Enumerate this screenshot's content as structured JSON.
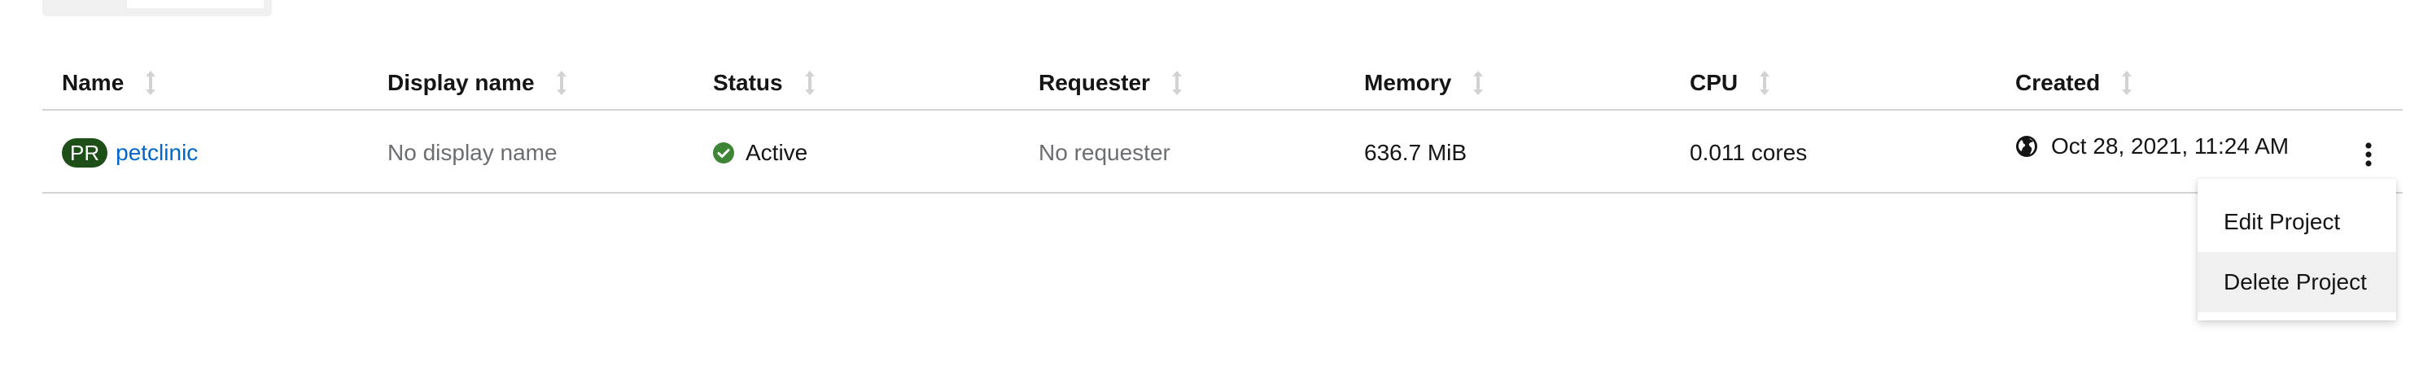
{
  "table": {
    "columns": [
      {
        "label": "Name"
      },
      {
        "label": "Display name"
      },
      {
        "label": "Status"
      },
      {
        "label": "Requester"
      },
      {
        "label": "Memory"
      },
      {
        "label": "CPU"
      },
      {
        "label": "Created"
      }
    ],
    "rows": [
      {
        "badge": "PR",
        "name": "petclinic",
        "display_name": "No display name",
        "status": "Active",
        "requester": "No requester",
        "memory": "636.7 MiB",
        "cpu": "0.011 cores",
        "created": "Oct 28, 2021, 11:24 AM"
      }
    ]
  },
  "menu": {
    "items": [
      {
        "label": "Edit Project"
      },
      {
        "label": "Delete Project"
      }
    ]
  },
  "colors": {
    "badge_bg": "#1e4f18",
    "link": "#0066cc",
    "status_success": "#3e8635",
    "muted_text": "#6a6e73",
    "border": "#d2d2d2"
  },
  "icons": {
    "sort": "sort-arrows-icon",
    "status": "check-circle-icon",
    "created": "globe-icon",
    "actions": "kebab-menu-icon"
  }
}
